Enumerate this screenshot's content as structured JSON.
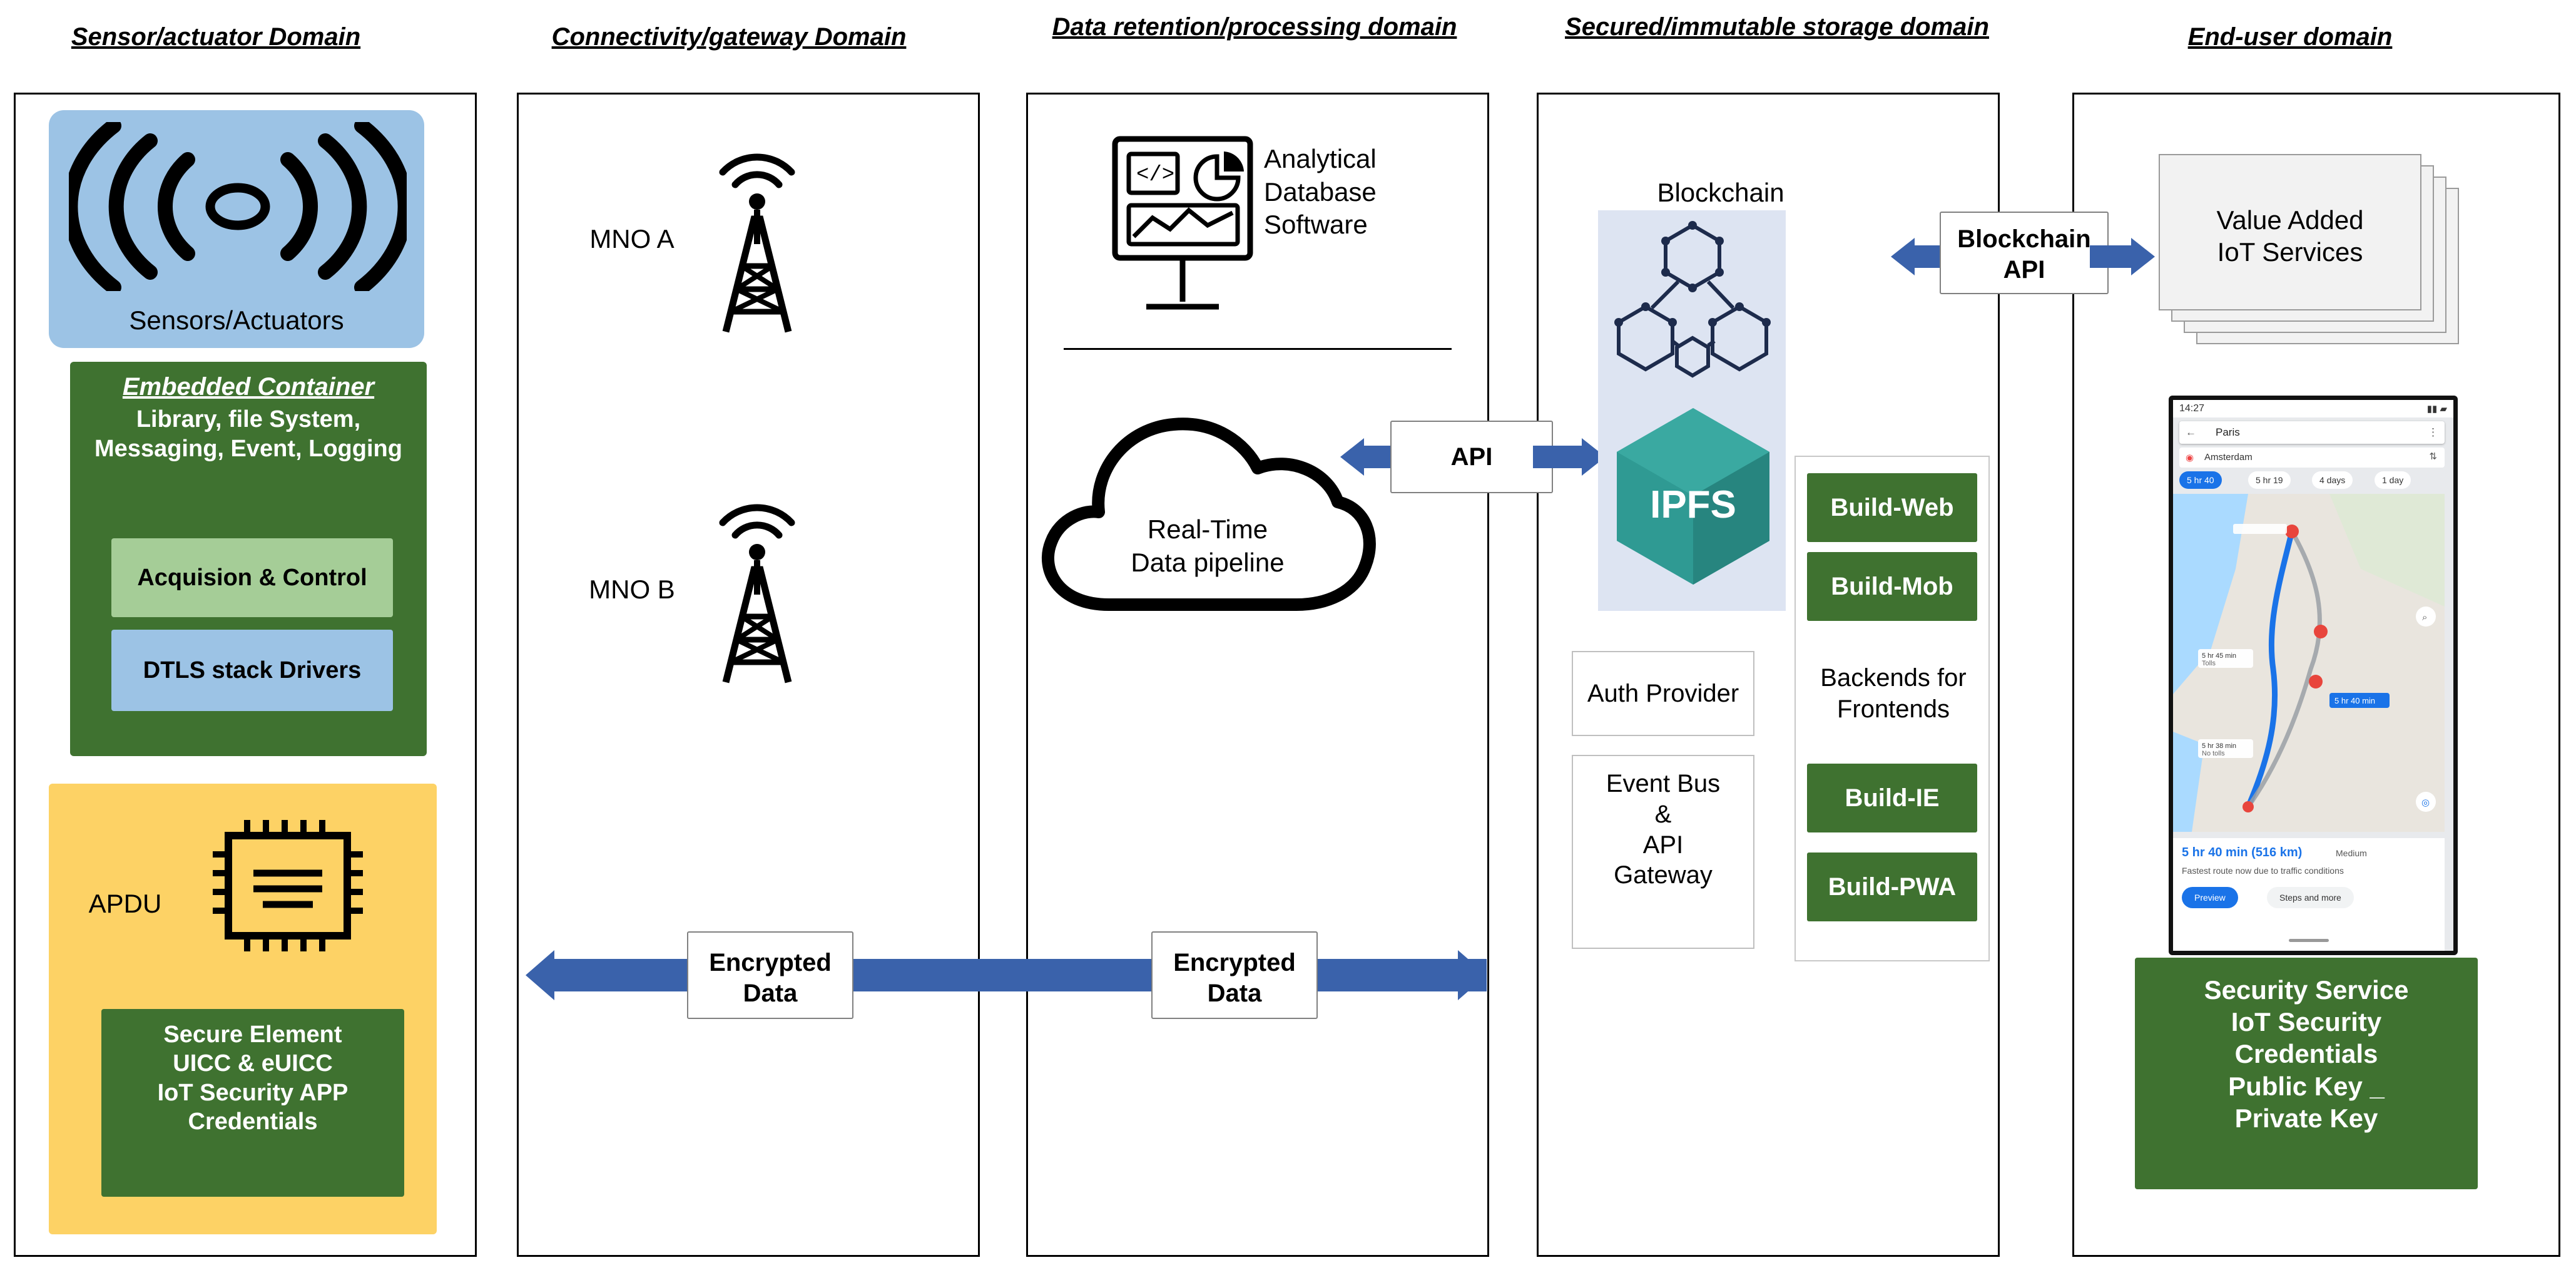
{
  "columns": [
    {
      "title": "Sensor/actuator Domain"
    },
    {
      "title": "Connectivity/gateway Domain"
    },
    {
      "title": "Data retention/processing domain"
    },
    {
      "title": "Secured/immutable storage domain"
    },
    {
      "title": "End-user domain"
    }
  ],
  "sensor_domain": {
    "sensors_label": "Sensors/Actuators",
    "embedded_container_title": "Embedded Container",
    "embedded_container_body": "Library, file System, Messaging, Event, Logging",
    "acquisition_control": "Acquision & Control",
    "dtls": "DTLS stack Drivers",
    "apdu_label": "APDU",
    "secure_element": "Secure Element UICC & eUICC IoT Security APP Credentials",
    "secure_element_lines": [
      "Secure Element",
      "UICC & eUICC",
      "IoT Security APP",
      "Credentials"
    ]
  },
  "connectivity_domain": {
    "mno_a": "MNO A",
    "mno_b": "MNO B"
  },
  "data_domain": {
    "analytical_db": "Analytical Database Software",
    "analytical_db_lines": [
      "Analytical",
      "Database",
      "Software"
    ],
    "pipeline": "Real-Time Data pipeline",
    "pipeline_lines": [
      "Real-Time",
      "Data pipeline"
    ],
    "api_label": "API"
  },
  "storage_domain": {
    "blockchain_label": "Blockchain",
    "ipfs_label": "IPFS",
    "auth_provider": "Auth Provider",
    "event_bus": "Event Bus & API Gateway",
    "event_bus_lines": [
      "Event Bus",
      "&",
      "API",
      "Gateway"
    ],
    "backends_title": "Backends for Frontends",
    "backends_title_lines": [
      "Backends for",
      "Frontends"
    ],
    "buttons": [
      "Build-Web",
      "Build-Mob",
      "Build-IE",
      "Build-PWA"
    ]
  },
  "enduser_domain": {
    "value_added": "Value Added IoT Services",
    "value_added_lines": [
      "Value Added",
      "IoT Services"
    ],
    "blockchain_api": "Blockchain API",
    "blockchain_api_lines": [
      "Blockchain",
      "API"
    ],
    "security_service_lines": [
      "Security Service",
      "IoT Security",
      "Credentials",
      "Public Key _",
      "Private Key"
    ]
  },
  "arrows": {
    "encrypted_data_1": "Encrypted Data",
    "encrypted_data_2": "Encrypted Data",
    "encrypted_lines": [
      "Encrypted",
      "Data"
    ]
  },
  "map_phone": {
    "time": "14:27",
    "search_value": "Paris",
    "origin": "Amsterdam",
    "route_options": [
      "5 hr 40",
      "5 hr 19",
      "4 days",
      "1 day"
    ],
    "badge_time": "5 hr 40 min",
    "summary": "5 hr 40 min (516 km)",
    "traffic_note": "Fastest route now due to traffic conditions",
    "buttons": [
      "Preview",
      "Steps and more"
    ],
    "medium_label": "Medium",
    "callouts": [
      "5 hr 45 min Tolls",
      "5 hr 38 min No tolls"
    ]
  },
  "colors": {
    "green": "#3f7230",
    "light_green": "#a5cd97",
    "blue": "#9cc3e5",
    "yellow": "#fdd265",
    "arrow_blue": "#3a62ab",
    "band": "#dde4f2",
    "ipfs_teal": "#2f9a93"
  }
}
